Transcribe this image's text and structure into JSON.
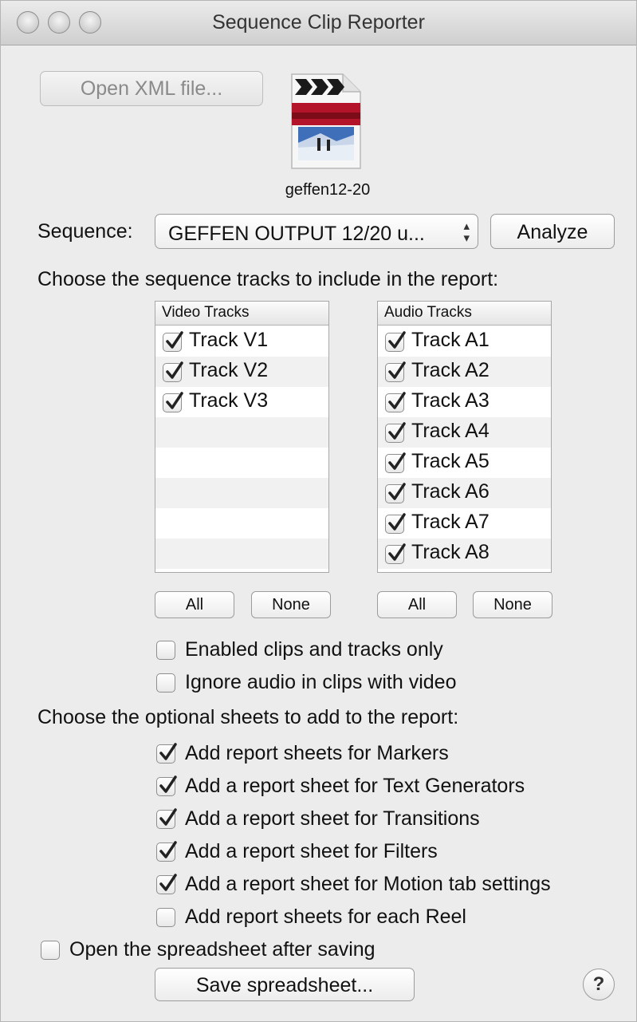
{
  "window": {
    "title": "Sequence Clip Reporter"
  },
  "toolbar": {
    "open_xml_label": "Open XML file...",
    "analyze_label": "Analyze"
  },
  "file": {
    "name": "geffen12-20",
    "icon": "fcp-xml-document-icon"
  },
  "sequence": {
    "label": "Sequence:",
    "selected": "GEFFEN OUTPUT 12/20 u..."
  },
  "tracks_heading": "Choose the sequence tracks to include in the report:",
  "video_tracks": {
    "header": "Video Tracks",
    "items": [
      {
        "label": "Track V1",
        "checked": true
      },
      {
        "label": "Track V2",
        "checked": true
      },
      {
        "label": "Track V3",
        "checked": true
      }
    ],
    "all_label": "All",
    "none_label": "None"
  },
  "audio_tracks": {
    "header": "Audio Tracks",
    "items": [
      {
        "label": "Track A1",
        "checked": true
      },
      {
        "label": "Track A2",
        "checked": true
      },
      {
        "label": "Track A3",
        "checked": true
      },
      {
        "label": "Track A4",
        "checked": true
      },
      {
        "label": "Track A5",
        "checked": true
      },
      {
        "label": "Track A6",
        "checked": true
      },
      {
        "label": "Track A7",
        "checked": true
      },
      {
        "label": "Track A8",
        "checked": true
      }
    ],
    "all_label": "All",
    "none_label": "None"
  },
  "track_options": [
    {
      "label": "Enabled clips and tracks only",
      "checked": false
    },
    {
      "label": "Ignore audio in clips with video",
      "checked": false
    }
  ],
  "sheets_heading": "Choose the optional sheets to add to the report:",
  "sheet_options": [
    {
      "label": "Add report sheets for Markers",
      "checked": true
    },
    {
      "label": "Add a report sheet for Text Generators",
      "checked": true
    },
    {
      "label": "Add a report sheet for Transitions",
      "checked": true
    },
    {
      "label": "Add a report sheet for Filters",
      "checked": true
    },
    {
      "label": "Add a report sheet for Motion tab settings",
      "checked": true
    },
    {
      "label": "Add report sheets for each Reel",
      "checked": false
    }
  ],
  "open_after_saving": {
    "label": "Open the spreadsheet after saving",
    "checked": false
  },
  "save_label": "Save spreadsheet...",
  "help_label": "?"
}
